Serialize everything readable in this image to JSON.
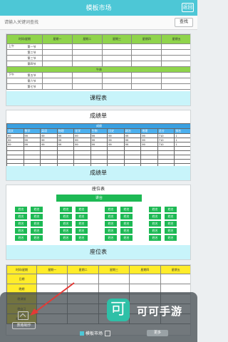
{
  "header": {
    "title": "模板市场",
    "return_label": "返回"
  },
  "search": {
    "placeholder": "请输入关键词查找",
    "button_label": "查找"
  },
  "schedule_card": {
    "time_label": "时间/星期",
    "days": [
      "星期一",
      "星期二",
      "星期三",
      "星期四",
      "星期五"
    ],
    "morning": "上午",
    "afternoon": "下午",
    "lunch": "午休",
    "periods_am": [
      "第一节",
      "第二节",
      "第三节",
      "第四节"
    ],
    "periods_pm": [
      "第五节",
      "第六节",
      "第七节"
    ],
    "caption": "课程表"
  },
  "score_card": {
    "title": "成绩单",
    "subject_band": "成绩",
    "headers": [
      "语文",
      "数学",
      "英语",
      "物理",
      "化学",
      "生物",
      "历史",
      "政治",
      "地理",
      "总分",
      "排名"
    ],
    "rows": [
      [
        "99",
        "99",
        "99",
        "99",
        "99",
        "99",
        "99",
        "99",
        "99",
        "710",
        "1"
      ],
      [
        "99",
        "99",
        "99",
        "99",
        "99",
        "99",
        "99",
        "99",
        "99",
        "710",
        "1"
      ],
      [
        "99",
        "99",
        "99",
        "99",
        "99",
        "99",
        "99",
        "99",
        "99",
        "710",
        "1"
      ]
    ],
    "caption": "成绩单"
  },
  "seat_card": {
    "title": "座位表",
    "podium": "讲台",
    "seat_name": "姓名",
    "caption": "座位表"
  },
  "yellow_card": {
    "time_label": "时间/星期",
    "days": [
      "星期一",
      "星期二",
      "星期三",
      "星期四",
      "星期五"
    ],
    "rows": [
      "日期",
      "晚期",
      "晚课前",
      "晚自习",
      "晚自习二"
    ]
  },
  "bottom": {
    "left_label": "表格制作",
    "middle_label": "模板市场",
    "right_label": "更多"
  },
  "watermark": {
    "logo_char": "可",
    "text": "可可手游"
  },
  "colors": {
    "accent": "#4dc7d6",
    "green": "#8fd44c",
    "seat_green": "#1db954",
    "yellow": "#ffec2a",
    "caption_bg": "#c8f4fa"
  }
}
